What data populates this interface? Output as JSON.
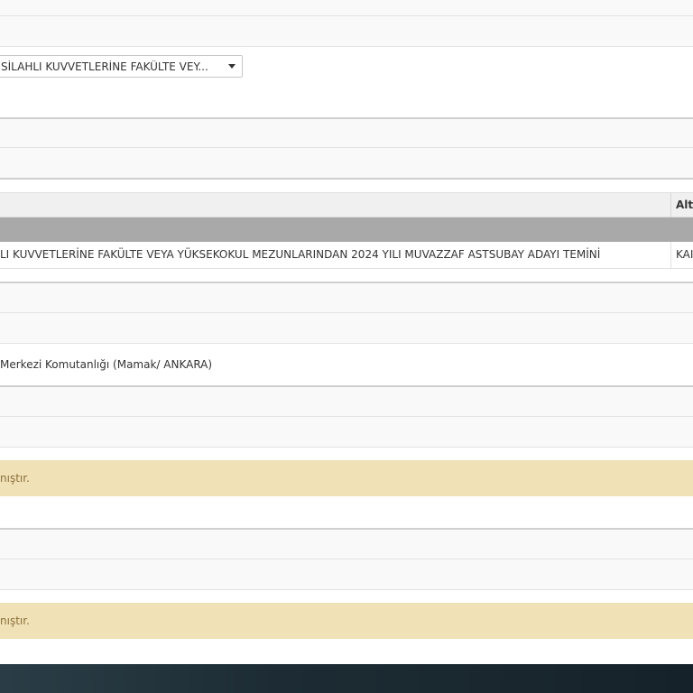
{
  "form": {
    "category_select": {
      "selected_text": "SİLAHLI KUVVETLERİNE FAKÜLTE VEY..."
    }
  },
  "table": {
    "header_alt": "Alt",
    "rows": [
      {
        "main": "LI KUVVETLERİNE FAKÜLTE VEYA YÜKSEKOKUL MEZUNLARINDAN 2024 YILI MUVAZZAF ASTSUBAY ADAYI TEMİNİ",
        "alt": "KAI"
      }
    ]
  },
  "location": {
    "text": "Merkezi Komutanlığı (Mamak/ ANKARA)"
  },
  "notices": [
    {
      "text": "nıştır."
    },
    {
      "text": "nıştır."
    }
  ],
  "colors": {
    "notice_bg": "#f0e2b6",
    "notice_text": "#8a6d3b",
    "group_row_bg": "#a9a9a9",
    "footer_bg": "#1d2c34"
  }
}
